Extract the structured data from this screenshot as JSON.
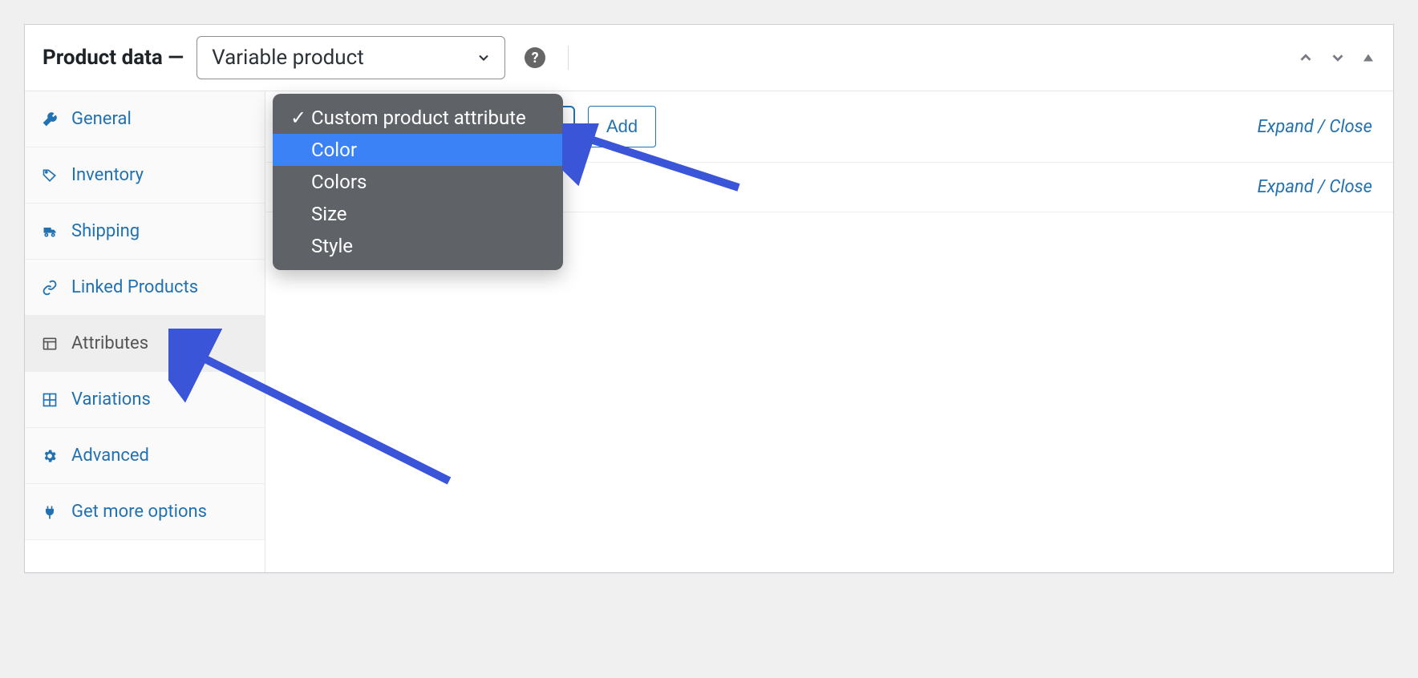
{
  "header": {
    "title": "Product data —",
    "product_type": "Variable product"
  },
  "sidebar": {
    "items": [
      {
        "label": "General",
        "icon": "wrench-icon"
      },
      {
        "label": "Inventory",
        "icon": "tag-icon"
      },
      {
        "label": "Shipping",
        "icon": "truck-icon"
      },
      {
        "label": "Linked Products",
        "icon": "link-icon"
      },
      {
        "label": "Attributes",
        "icon": "list-icon"
      },
      {
        "label": "Variations",
        "icon": "grid-icon"
      },
      {
        "label": "Advanced",
        "icon": "gear-icon"
      },
      {
        "label": "Get more options",
        "icon": "plug-icon"
      }
    ],
    "active_index": 4
  },
  "attribute_dropdown": {
    "options": [
      "Custom product attribute",
      "Color",
      "Colors",
      "Size",
      "Style"
    ],
    "selected_index": 0,
    "highlight_index": 1
  },
  "buttons": {
    "add": "Add"
  },
  "links": {
    "expand_close": "Expand / Close"
  }
}
